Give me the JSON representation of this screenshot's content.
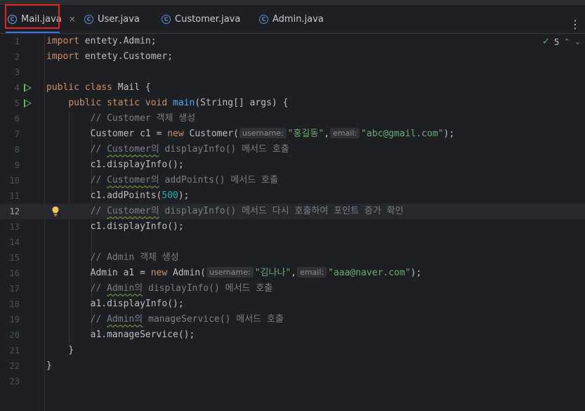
{
  "tabs": [
    {
      "label": "Mail.java",
      "active": true,
      "close": "×"
    },
    {
      "label": "User.java",
      "active": false
    },
    {
      "label": "Customer.java",
      "active": false
    },
    {
      "label": "Admin.java",
      "active": false
    }
  ],
  "tab_menu": "⋮",
  "inspections": {
    "count": "5",
    "up": "⌃",
    "down": "⌄"
  },
  "current_line": 12,
  "lines": {
    "n1": "1",
    "n2": "2",
    "n3": "3",
    "n4": "4",
    "n5": "5",
    "n6": "6",
    "n7": "7",
    "n8": "8",
    "n9": "9",
    "n10": "10",
    "n11": "11",
    "n12": "12",
    "n13": "13",
    "n14": "14",
    "n15": "15",
    "n16": "16",
    "n17": "17",
    "n18": "18",
    "n19": "19",
    "n20": "20",
    "n21": "21",
    "n22": "22",
    "n23": "23"
  },
  "code": {
    "l1_kw": "import",
    "l1_rest": " entety.Admin;",
    "l2_kw": "import",
    "l2_rest": " entety.Customer;",
    "l4_kw": "public class",
    "l4_rest": " Mail {",
    "l5_kw": "public static void",
    "l5_fn": "main",
    "l5_rest": "(String[] args) {",
    "l6": "// Customer 객체 생성",
    "l7_a": "Customer c1 = ",
    "l7_kw": "new",
    "l7_b": " Customer(",
    "l7_hint1": "username:",
    "l7_s1": "\"홍길동\"",
    "l7_comma": ",",
    "l7_hint2": "email:",
    "l7_s2": "\"abc@gmail.com\"",
    "l7_end": ");",
    "l8_a": "// ",
    "l8_sq": "Customer의",
    "l8_b": " displayInfo() 메서드 호출",
    "l9": "c1.displayInfo();",
    "l10_a": "// ",
    "l10_sq": "Customer의",
    "l10_b": " addPoints() 메서드 호출",
    "l11_a": "c1.addPoints(",
    "l11_n": "500",
    "l11_b": ");",
    "l12_a": "// ",
    "l12_sq": "Customer의",
    "l12_b": " displayInfo() 메서드 다시 호출하여 포인트 증가 확인",
    "l13": "c1.displayInfo();",
    "l15": "// Admin 객체 생성",
    "l16_a": "Admin a1 = ",
    "l16_kw": "new",
    "l16_b": " Admin(",
    "l16_hint1": "username:",
    "l16_s1": "\"김나나\"",
    "l16_comma": ",",
    "l16_hint2": "email:",
    "l16_s2": "\"aaa@naver.com\"",
    "l16_end": ");",
    "l17_a": "// ",
    "l17_sq": "Admin의",
    "l17_b": " displayInfo() 메서드 호출",
    "l18": "a1.displayInfo();",
    "l19_a": "// ",
    "l19_sq": "Admin의",
    "l19_b": " manageService() 메서드 호출",
    "l20": "a1.manageService();",
    "l21": "}",
    "l22": "}"
  },
  "colors": {
    "keyword": "#cf8e6d",
    "function": "#56a8f5",
    "comment": "#7a7e85",
    "string": "#6aab73",
    "number": "#2aacb8",
    "accent": "#3574f0",
    "highlight": "#e5251f"
  }
}
